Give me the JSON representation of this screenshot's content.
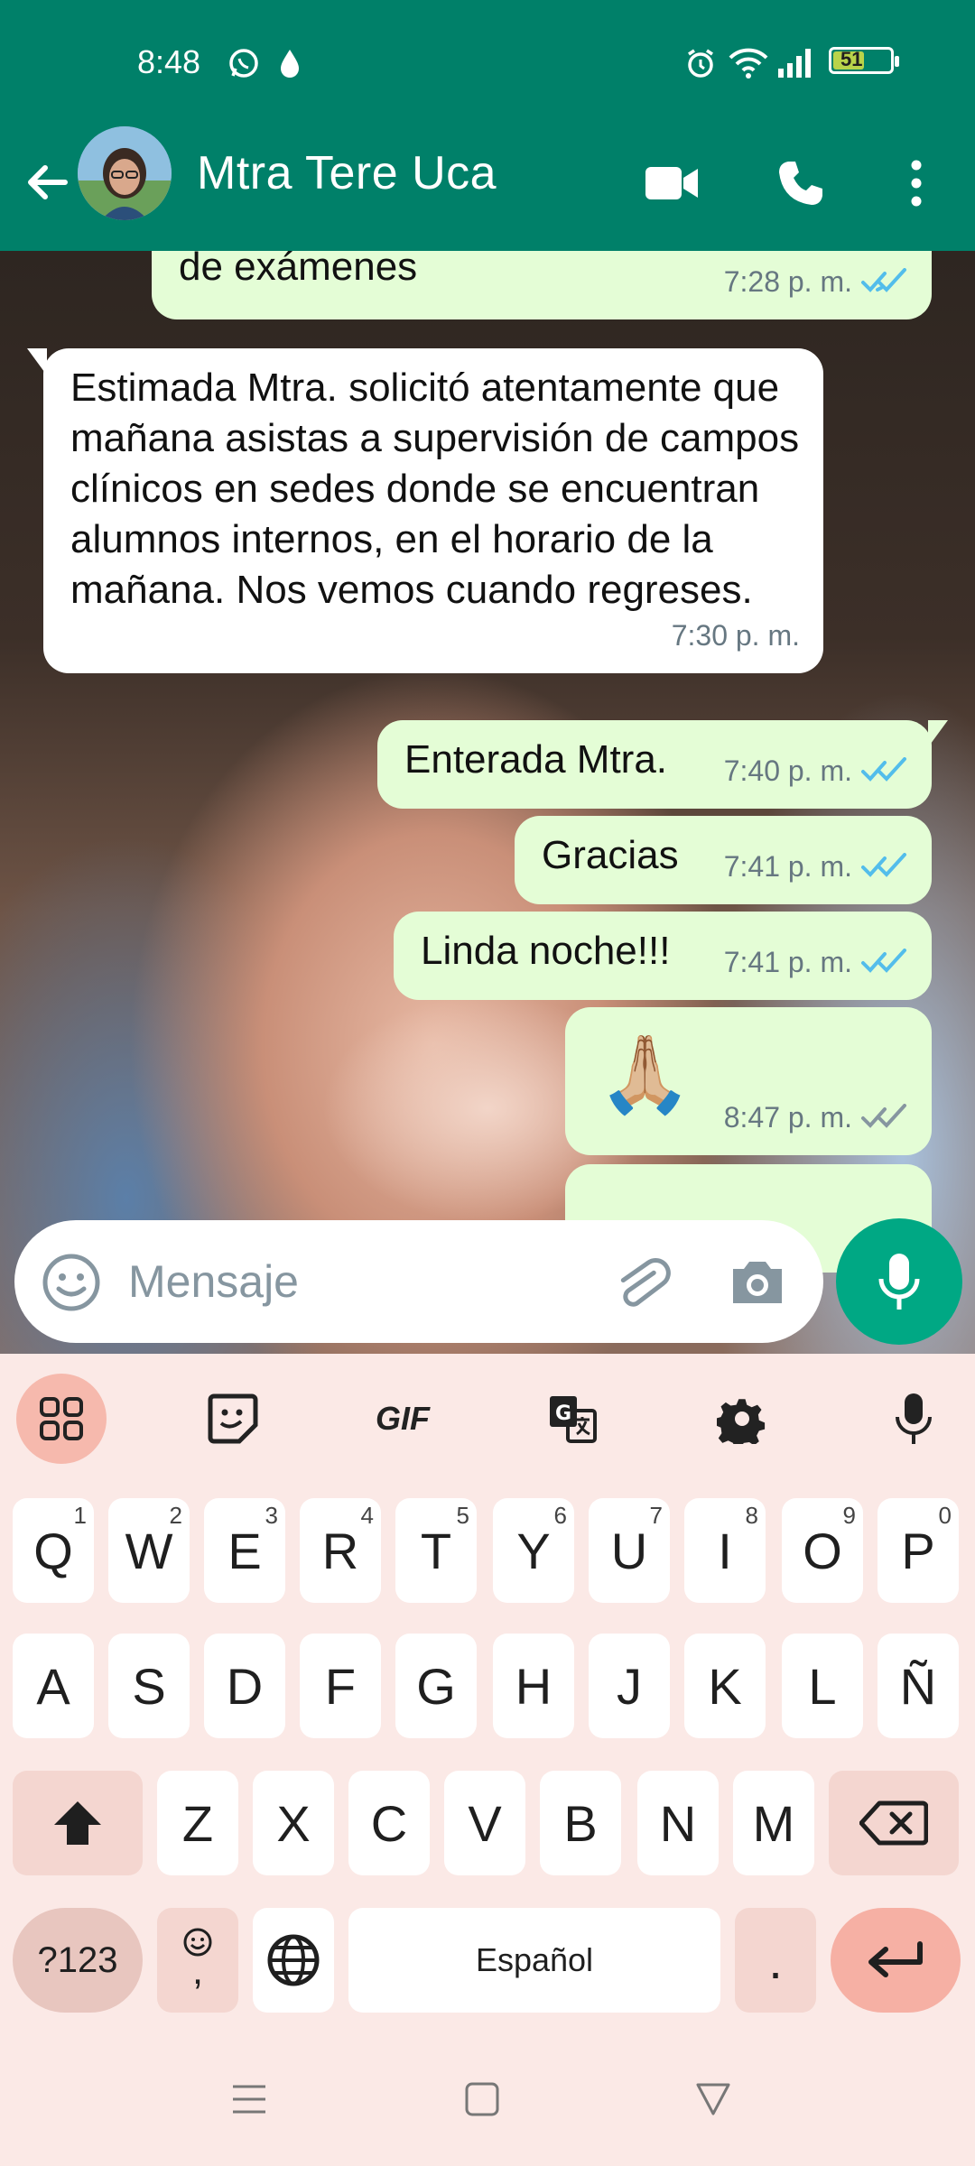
{
  "status_bar": {
    "time": "8:48",
    "battery": "51"
  },
  "header": {
    "contact_name": "Mtra Tere Uca"
  },
  "messages": [
    {
      "text": "de exámenes",
      "time": "7:28 p. m."
    },
    {
      "text": "Estimada Mtra. solicitó atentamente que mañana asistas a supervisión de campos clínicos en sedes donde se encuentran alumnos internos, en el horario de la mañana. Nos vemos cuando regreses.",
      "time": "7:30 p. m."
    },
    {
      "text": "Enterada Mtra.",
      "time": "7:40 p. m."
    },
    {
      "text": "Gracias",
      "time": "7:41 p. m."
    },
    {
      "text": "Linda noche!!!",
      "time": "7:41 p. m."
    },
    {
      "text": "🙏🏼",
      "time": "8:47 p. m."
    }
  ],
  "composer": {
    "placeholder": "Mensaje"
  },
  "keyboard": {
    "row1": [
      {
        "k": "Q",
        "h": "1"
      },
      {
        "k": "W",
        "h": "2"
      },
      {
        "k": "E",
        "h": "3"
      },
      {
        "k": "R",
        "h": "4"
      },
      {
        "k": "T",
        "h": "5"
      },
      {
        "k": "Y",
        "h": "6"
      },
      {
        "k": "U",
        "h": "7"
      },
      {
        "k": "I",
        "h": "8"
      },
      {
        "k": "O",
        "h": "9"
      },
      {
        "k": "P",
        "h": "0"
      }
    ],
    "row2": [
      "A",
      "S",
      "D",
      "F",
      "G",
      "H",
      "J",
      "K",
      "L",
      "Ñ"
    ],
    "row3": [
      "Z",
      "X",
      "C",
      "V",
      "B",
      "N",
      "M"
    ],
    "sym_label": "?123",
    "emoji_comma": ",",
    "space_label": "Español",
    "period": ".",
    "toolbar_gif": "GIF"
  },
  "colors": {
    "header": "#008069",
    "outgoing": "#e4fdd6",
    "incoming": "#ffffff",
    "accent": "#00a884",
    "read_tick": "#53bdeb",
    "sent_tick": "#8696a0"
  },
  "icons": {
    "header": [
      "back-arrow-icon",
      "video-call-icon",
      "phone-icon",
      "more-vert-icon"
    ],
    "composer": [
      "emoji-icon",
      "attach-icon",
      "camera-icon",
      "mic-icon"
    ],
    "toolbar": [
      "apps-grid-icon",
      "sticker-icon",
      "gif-icon",
      "translate-icon",
      "settings-icon",
      "voice-input-icon"
    ]
  }
}
